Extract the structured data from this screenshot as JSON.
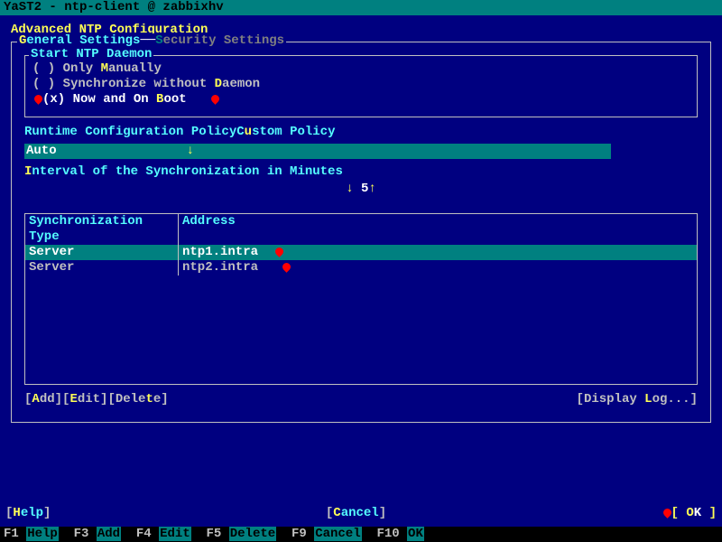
{
  "titlebar": "YaST2 - ntp-client @ zabbixhv",
  "heading": "Advanced NTP Configuration",
  "tabs": {
    "general": "General Settings",
    "security": "Security Settings"
  },
  "daemon_group": {
    "title": "Start NTP Daemon",
    "radios": {
      "manual": {
        "label": "Only Manually",
        "hotkey_index": 5
      },
      "sync": {
        "label": "Synchronize without Daemon",
        "hotkey_index": 20
      },
      "boot": {
        "label": "Now and On Boot",
        "hotkey_index": 11
      }
    },
    "selected": "boot"
  },
  "runtime": {
    "policy_label": "Runtime Configuration Policy",
    "policy_value": "Auto",
    "custom_label": "Custom Policy",
    "custom_value": ""
  },
  "interval": {
    "label": "Interval of the Synchronization in Minutes",
    "value": "5"
  },
  "servers": {
    "headers": {
      "type": "Synchronization Type",
      "addr": "Address"
    },
    "rows": [
      {
        "type": "Server",
        "addr": "ntp1.intra",
        "selected": true
      },
      {
        "type": "Server",
        "addr": "ntp2.intra",
        "selected": false
      }
    ]
  },
  "row_actions": {
    "add": "Add",
    "edit": "Edit",
    "delete": "Delete",
    "display_log": "Display Log..."
  },
  "bottom": {
    "help": "Help",
    "cancel": "Cancel",
    "ok": "OK"
  },
  "fkeys": {
    "f1": "Help",
    "f3": "Add",
    "f4": "Edit",
    "f5": "Delete",
    "f9": "Cancel",
    "f10": "OK"
  }
}
